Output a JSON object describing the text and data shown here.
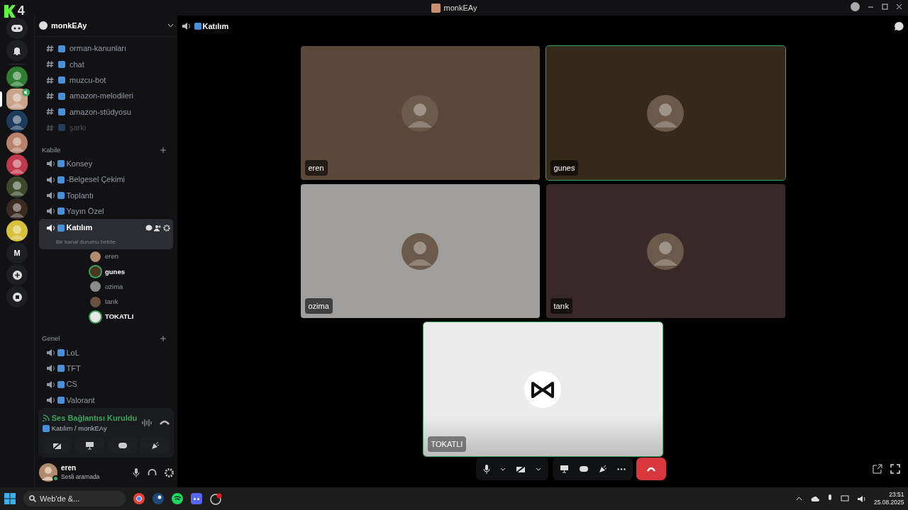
{
  "window": {
    "title": "monkEAy",
    "logo_number": "4"
  },
  "rail": [
    {
      "kind": "app",
      "selected": false
    },
    {
      "kind": "notifications",
      "selected": false
    },
    {
      "kind": "server",
      "color": "#2e7d32",
      "selected": false
    },
    {
      "kind": "server",
      "color": "#c9a38a",
      "selected": true,
      "in_voice": true
    },
    {
      "kind": "server",
      "color": "#1d3b5c",
      "selected": false
    },
    {
      "kind": "server",
      "color": "#b8826a",
      "selected": false
    },
    {
      "kind": "server",
      "color": "#c0394b",
      "selected": false
    },
    {
      "kind": "server",
      "color": "#3d4a2a",
      "selected": false
    },
    {
      "kind": "server",
      "color": "#3a2a20",
      "selected": false
    },
    {
      "kind": "server",
      "color": "#d8c13a",
      "selected": false
    },
    {
      "kind": "letter",
      "label": "M",
      "selected": false
    },
    {
      "kind": "add",
      "selected": false
    },
    {
      "kind": "discover",
      "selected": false
    }
  ],
  "server": {
    "name": "monkEAy"
  },
  "text_channels": [
    {
      "name": "orman-kanunları",
      "muted": false
    },
    {
      "name": "chat",
      "muted": false
    },
    {
      "name": "muzcu-bot",
      "muted": false
    },
    {
      "name": "amazon-melodileri",
      "muted": false
    },
    {
      "name": "amazon-stüdyosu",
      "muted": false
    },
    {
      "name": "şarkı",
      "muted": true
    }
  ],
  "categories": [
    {
      "name": "Kabile",
      "channels": [
        {
          "name": "Konsey",
          "selected": false
        },
        {
          "name": "-Belgesel Çekimi",
          "selected": false
        },
        {
          "name": "Toplantı",
          "selected": false
        },
        {
          "name": "Yayın Özel",
          "selected": false
        },
        {
          "name": "Katılım",
          "selected": true,
          "status": "Bir kanal durumu belirle",
          "members": [
            {
              "name": "eren",
              "speaking": false,
              "color": "#b08a6a"
            },
            {
              "name": "gunes",
              "speaking": true,
              "color": "#4a3520"
            },
            {
              "name": "ozima",
              "speaking": false,
              "color": "#8a8a8a"
            },
            {
              "name": "tarık",
              "speaking": false,
              "color": "#6a5040"
            },
            {
              "name": "TOKATLI",
              "speaking": true,
              "color": "#e8e8e8"
            }
          ]
        }
      ]
    },
    {
      "name": "Genel",
      "channels": [
        {
          "name": "LoL",
          "selected": false
        },
        {
          "name": "TFT",
          "selected": false
        },
        {
          "name": "CS",
          "selected": false
        },
        {
          "name": "Valorant",
          "selected": false
        }
      ]
    }
  ],
  "voice_panel": {
    "status": "Ses Bağlantısı Kuruldu",
    "location": "Katılım / monkEAy"
  },
  "user": {
    "name": "eren",
    "activity": "Sesli aramada"
  },
  "header": {
    "channel": "Katılım"
  },
  "tiles": [
    {
      "name": "eren",
      "kind": "avatar",
      "color": "#5a4838",
      "speaking": false
    },
    {
      "name": "gunes",
      "kind": "avatar",
      "color": "#35291a",
      "speaking": true
    },
    {
      "name": "ozima",
      "kind": "avatar",
      "color": "#a19f9e",
      "speaking": false
    },
    {
      "name": "tarık",
      "kind": "avatar",
      "color": "#382829",
      "speaking": false
    },
    {
      "name": "TOKATLI",
      "kind": "logo",
      "color": "#ececec",
      "speaking": true
    }
  ],
  "taskbar": {
    "search": "Web'de &...",
    "time": "23:51",
    "date": "25.08.2025"
  }
}
